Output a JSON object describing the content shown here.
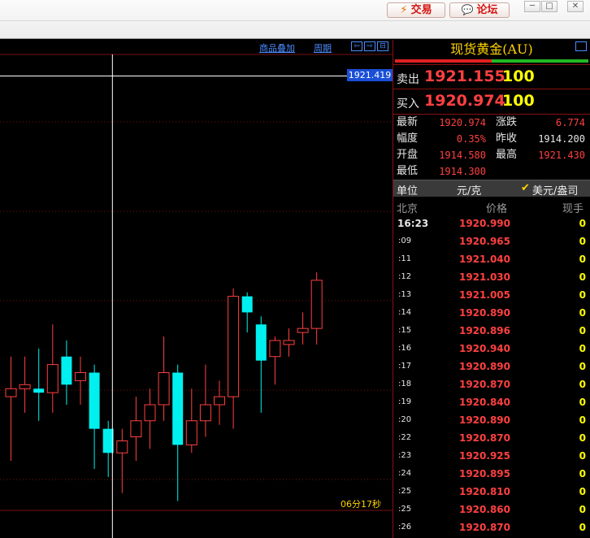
{
  "toolbar": {
    "trade_label": "交易",
    "forum_label": "论坛",
    "win_min": "─",
    "win_max": "□",
    "win_close": "✕"
  },
  "chart": {
    "links": [
      "商品叠加",
      "周期"
    ],
    "crosshair_price": "1921.419",
    "countdown": "06分17秒"
  },
  "chart_data": {
    "type": "candlestick",
    "candles": [
      {
        "o": 1920.62,
        "c": 1920.64,
        "h": 1920.72,
        "l": 1920.46
      },
      {
        "o": 1920.64,
        "c": 1920.65,
        "h": 1920.72,
        "l": 1920.58
      },
      {
        "o": 1920.64,
        "c": 1920.63,
        "h": 1920.74,
        "l": 1920.56
      },
      {
        "o": 1920.63,
        "c": 1920.7,
        "h": 1920.8,
        "l": 1920.58
      },
      {
        "o": 1920.72,
        "c": 1920.65,
        "h": 1920.76,
        "l": 1920.6
      },
      {
        "o": 1920.66,
        "c": 1920.68,
        "h": 1920.72,
        "l": 1920.6
      },
      {
        "o": 1920.68,
        "c": 1920.54,
        "h": 1920.7,
        "l": 1920.44
      },
      {
        "o": 1920.54,
        "c": 1920.48,
        "h": 1920.56,
        "l": 1920.42
      },
      {
        "o": 1920.48,
        "c": 1920.51,
        "h": 1920.54,
        "l": 1920.38
      },
      {
        "o": 1920.52,
        "c": 1920.56,
        "h": 1920.62,
        "l": 1920.46
      },
      {
        "o": 1920.56,
        "c": 1920.6,
        "h": 1920.64,
        "l": 1920.49
      },
      {
        "o": 1920.6,
        "c": 1920.68,
        "h": 1920.77,
        "l": 1920.56
      },
      {
        "o": 1920.68,
        "c": 1920.5,
        "h": 1920.7,
        "l": 1920.36
      },
      {
        "o": 1920.5,
        "c": 1920.56,
        "h": 1920.64,
        "l": 1920.48
      },
      {
        "o": 1920.56,
        "c": 1920.6,
        "h": 1920.7,
        "l": 1920.52
      },
      {
        "o": 1920.6,
        "c": 1920.62,
        "h": 1920.66,
        "l": 1920.55
      },
      {
        "o": 1920.62,
        "c": 1920.87,
        "h": 1920.89,
        "l": 1920.54
      },
      {
        "o": 1920.87,
        "c": 1920.83,
        "h": 1920.88,
        "l": 1920.78
      },
      {
        "o": 1920.8,
        "c": 1920.71,
        "h": 1920.82,
        "l": 1920.58
      },
      {
        "o": 1920.72,
        "c": 1920.76,
        "h": 1920.77,
        "l": 1920.65
      },
      {
        "o": 1920.75,
        "c": 1920.76,
        "h": 1920.79,
        "l": 1920.72
      },
      {
        "o": 1920.78,
        "c": 1920.79,
        "h": 1920.83,
        "l": 1920.75
      },
      {
        "o": 1920.79,
        "c": 1920.91,
        "h": 1920.93,
        "l": 1920.75
      }
    ],
    "ylim": [
      1920.268,
      1921.509
    ],
    "crosshair": {
      "price": 1921.419,
      "index": 7.3
    },
    "colors": {
      "up": "#ff4040",
      "down": "#00f0f0",
      "grid": "#7a1010",
      "cross": "#ffffff"
    }
  },
  "panel": {
    "title": "现货黄金(AU)",
    "ratio": 0.5,
    "sell": {
      "label": "卖出",
      "price": "1921.155",
      "volume": "100"
    },
    "buy": {
      "label": "买入",
      "price": "1920.974",
      "volume": "100"
    },
    "stats": {
      "latest_label": "最新",
      "latest": "1920.974",
      "change_label": "涨跌",
      "change": "6.774",
      "range_label": "幅度",
      "range": "0.35%",
      "prev_label": "昨收",
      "prev": "1914.200",
      "open_label": "开盘",
      "open": "1914.580",
      "high_label": "最高",
      "high": "1921.430",
      "low_label": "最低",
      "low": "1914.300"
    },
    "unit": {
      "label": "单位",
      "value": "元/克",
      "alt": "美元/盎司"
    },
    "tick_header": {
      "time": "北京",
      "price": "价格",
      "vol": "现手"
    },
    "ticks": [
      {
        "time": "16:23",
        "price": "1920.990",
        "vol": "0"
      },
      {
        "time": ":09",
        "price": "1920.965",
        "vol": "0"
      },
      {
        "time": ":11",
        "price": "1921.040",
        "vol": "0"
      },
      {
        "time": ":12",
        "price": "1921.030",
        "vol": "0"
      },
      {
        "time": ":13",
        "price": "1921.005",
        "vol": "0"
      },
      {
        "time": ":14",
        "price": "1920.890",
        "vol": "0"
      },
      {
        "time": ":15",
        "price": "1920.896",
        "vol": "0"
      },
      {
        "time": ":16",
        "price": "1920.940",
        "vol": "0"
      },
      {
        "time": ":17",
        "price": "1920.890",
        "vol": "0"
      },
      {
        "time": ":18",
        "price": "1920.870",
        "vol": "0"
      },
      {
        "time": ":19",
        "price": "1920.840",
        "vol": "0"
      },
      {
        "time": ":20",
        "price": "1920.890",
        "vol": "0"
      },
      {
        "time": ":22",
        "price": "1920.870",
        "vol": "0"
      },
      {
        "time": ":23",
        "price": "1920.925",
        "vol": "0"
      },
      {
        "time": ":24",
        "price": "1920.895",
        "vol": "0"
      },
      {
        "time": ":25",
        "price": "1920.810",
        "vol": "0"
      },
      {
        "time": ":25",
        "price": "1920.860",
        "vol": "0"
      },
      {
        "time": ":26",
        "price": "1920.870",
        "vol": "0"
      }
    ]
  }
}
